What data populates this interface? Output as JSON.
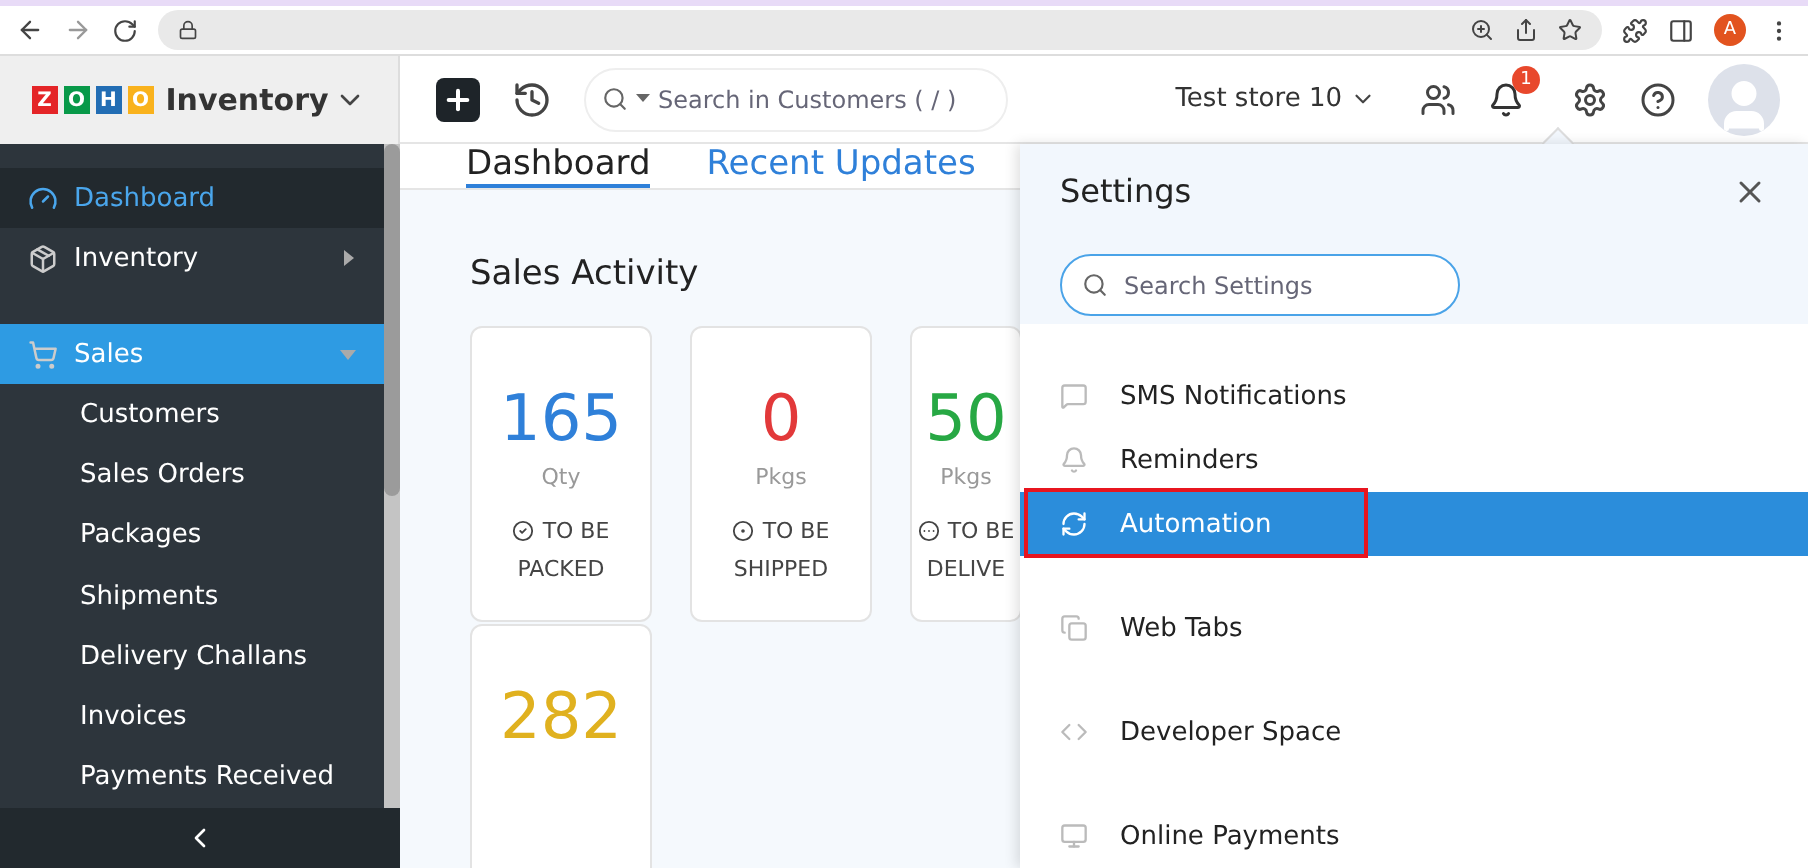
{
  "browser": {
    "profile_initial": "A"
  },
  "header": {
    "logo_letters": [
      "Z",
      "O",
      "H",
      "O"
    ],
    "app_name": "Inventory",
    "search": {
      "placeholder": "Search in Customers ( / )"
    },
    "org": "Test store 10",
    "notification_count": "1"
  },
  "sidebar": {
    "items": [
      {
        "label": "Dashboard",
        "kind": "top",
        "selected": true
      },
      {
        "label": "Inventory",
        "kind": "top",
        "selected": false,
        "expanded": false
      },
      {
        "label": "Sales",
        "kind": "section",
        "selected": false,
        "expanded": true,
        "children": [
          {
            "label": "Customers"
          },
          {
            "label": "Sales Orders"
          },
          {
            "label": "Packages"
          },
          {
            "label": "Shipments"
          },
          {
            "label": "Delivery Challans"
          },
          {
            "label": "Invoices"
          },
          {
            "label": "Payments Received"
          }
        ]
      }
    ]
  },
  "tabs": [
    {
      "label": "Dashboard",
      "selected": true
    },
    {
      "label": "Recent Updates",
      "selected": false
    }
  ],
  "sales_activity": {
    "title": "Sales Activity",
    "cards": [
      {
        "value": "165",
        "unit": "Qty",
        "label_1": "TO BE",
        "label_2": "PACKED",
        "color": "#2f80d9"
      },
      {
        "value": "0",
        "unit": "Pkgs",
        "label_1": "TO BE",
        "label_2": "SHIPPED",
        "color": "#e2393a"
      },
      {
        "value": "50",
        "unit": "Pkgs",
        "label_1": "TO BE",
        "label_2": "DELIVE",
        "color": "#27a844"
      },
      {
        "value": "282",
        "color": "#e0b11f"
      }
    ]
  },
  "settings": {
    "title": "Settings",
    "search": {
      "placeholder": "Search Settings"
    },
    "groups": [
      [
        {
          "label": "SMS Notifications",
          "selected": false,
          "highlighted": false
        },
        {
          "label": "Reminders",
          "selected": false,
          "highlighted": false
        },
        {
          "label": "Automation",
          "selected": true,
          "highlighted": true
        }
      ],
      [
        {
          "label": "Web Tabs",
          "selected": false,
          "highlighted": false
        }
      ],
      [
        {
          "label": "Developer Space",
          "selected": false,
          "highlighted": false
        }
      ],
      [
        {
          "label": "Online Payments",
          "selected": false,
          "highlighted": false
        }
      ]
    ]
  }
}
